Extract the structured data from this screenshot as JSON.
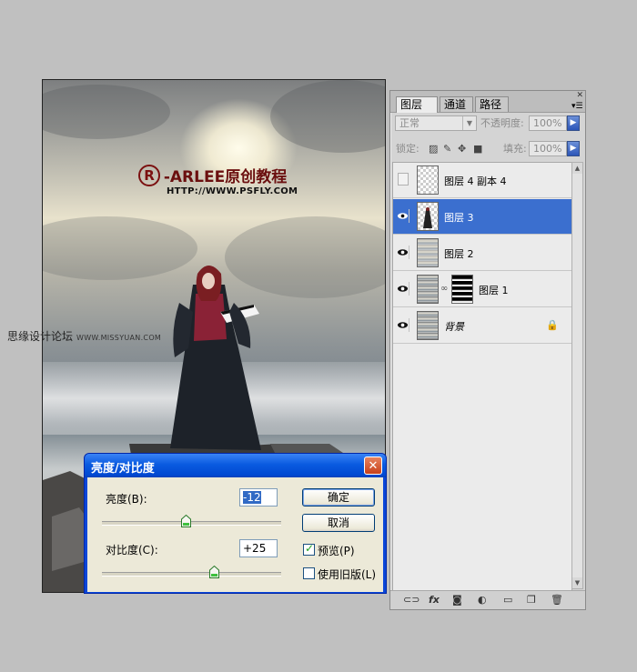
{
  "canvas": {
    "logo_mark": "R",
    "logo_text": "-ARLEE原创教程",
    "logo_url": "HTTP://WWW.PSFLY.COM"
  },
  "watermark": {
    "text": "思缘设计论坛",
    "url": "WWW.MISSYUAN.COM"
  },
  "layers_panel": {
    "tabs": [
      "图层",
      "通道",
      "路径"
    ],
    "tab_close": "×",
    "blend_mode": "正常",
    "opacity_label": "不透明度:",
    "opacity_value": "100%",
    "lock_label": "锁定:",
    "fill_label": "填充:",
    "fill_value": "100%",
    "layers": [
      {
        "name": "图层 4 副本 4",
        "visible": false,
        "selected": false
      },
      {
        "name": "图层 3",
        "visible": true,
        "selected": true
      },
      {
        "name": "图层 2",
        "visible": true,
        "selected": false
      },
      {
        "name": "图层 1",
        "visible": true,
        "selected": false
      },
      {
        "name": "背景",
        "visible": true,
        "selected": false
      }
    ]
  },
  "dialog": {
    "title": "亮度/对比度",
    "close": "✕",
    "brightness_label": "亮度(B):",
    "brightness_value": "-12",
    "brightness_fraction": 0.47,
    "contrast_label": "对比度(C):",
    "contrast_value": "+25",
    "contrast_fraction": 0.625,
    "ok_label": "确定",
    "cancel_label": "取消",
    "preview_label": "预览(P)",
    "preview_checked": true,
    "legacy_label": "使用旧版(L)",
    "legacy_checked": false
  },
  "colors": {
    "selection": "#3b6fcf",
    "dialog_title": "#0a5be0",
    "logo": "#6b0f0f"
  }
}
